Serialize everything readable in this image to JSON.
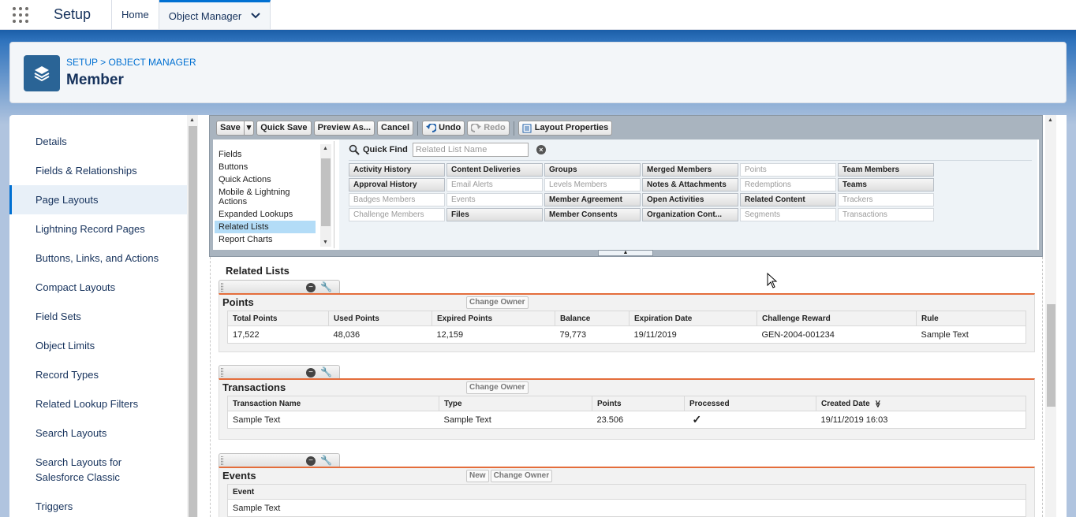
{
  "top_nav": {
    "app_name": "Setup",
    "tabs": [
      {
        "label": "Home"
      },
      {
        "label": "Object Manager"
      }
    ]
  },
  "header": {
    "breadcrumb_setup": "SETUP",
    "breadcrumb_sep": " > ",
    "breadcrumb_object_manager": "OBJECT MANAGER",
    "title": "Member",
    "icon": "layers-icon"
  },
  "sidebar": {
    "active": "Page Layouts",
    "items": [
      {
        "label": "Details"
      },
      {
        "label": "Fields & Relationships"
      },
      {
        "label": "Page Layouts"
      },
      {
        "label": "Lightning Record Pages"
      },
      {
        "label": "Buttons, Links, and Actions"
      },
      {
        "label": "Compact Layouts"
      },
      {
        "label": "Field Sets"
      },
      {
        "label": "Object Limits"
      },
      {
        "label": "Record Types"
      },
      {
        "label": "Related Lookup Filters"
      },
      {
        "label": "Search Layouts"
      },
      {
        "label": "Search Layouts for",
        "label2": "Salesforce Classic"
      },
      {
        "label": "Triggers"
      }
    ]
  },
  "toolbar": {
    "save": "Save",
    "save_dropdown": "▾",
    "quick_save": "Quick Save",
    "preview_as": "Preview As...",
    "cancel": "Cancel",
    "undo": "Undo",
    "redo": "Redo",
    "layout_properties": "Layout Properties"
  },
  "palette": {
    "categories": [
      {
        "label": "Fields"
      },
      {
        "label": "Buttons"
      },
      {
        "label": "Quick Actions"
      },
      {
        "label": "Mobile & Lightning Actions"
      },
      {
        "label": "Expanded Lookups"
      },
      {
        "label": "Related Lists"
      },
      {
        "label": "Report Charts"
      }
    ],
    "selected_category": "Related Lists",
    "quick_find_label": "Quick Find",
    "quick_find_placeholder": "Related List Name",
    "items": [
      {
        "label": "Activity History",
        "used": false
      },
      {
        "label": "Content Deliveries",
        "used": false
      },
      {
        "label": "Groups",
        "used": false
      },
      {
        "label": "Merged Members",
        "used": false
      },
      {
        "label": "Points",
        "used": true
      },
      {
        "label": "Team Members",
        "used": false
      },
      {
        "label": "Approval History",
        "used": false
      },
      {
        "label": "Email Alerts",
        "used": true
      },
      {
        "label": "Levels Members",
        "used": true
      },
      {
        "label": "Notes & Attachments",
        "used": false
      },
      {
        "label": "Redemptions",
        "used": true
      },
      {
        "label": "Teams",
        "used": false
      },
      {
        "label": "Badges Members",
        "used": true
      },
      {
        "label": "Events",
        "used": true
      },
      {
        "label": "Member Agreement",
        "used": false
      },
      {
        "label": "Open Activities",
        "used": false
      },
      {
        "label": "Related Content",
        "used": false
      },
      {
        "label": "Trackers",
        "used": true
      },
      {
        "label": "Challenge Members",
        "used": true
      },
      {
        "label": "Files",
        "used": false
      },
      {
        "label": "Member Consents",
        "used": false
      },
      {
        "label": "Organization Cont...",
        "used": false
      },
      {
        "label": "Segments",
        "used": true
      },
      {
        "label": "Transactions",
        "used": true
      }
    ],
    "handle_glyph": "▲"
  },
  "canvas": {
    "section_title": "Related Lists",
    "related_lists": [
      {
        "name": "Points",
        "buttons": [
          "Change Owner"
        ],
        "columns": [
          "Total Points",
          "Used Points",
          "Expired Points",
          "Balance",
          "Expiration Date",
          "Challenge Reward",
          "Rule"
        ],
        "row": [
          "17,522",
          "48,036",
          "12,159",
          "79,773",
          "19/11/2019",
          "GEN-2004-001234",
          "Sample Text"
        ]
      },
      {
        "name": "Transactions",
        "buttons": [
          "Change Owner"
        ],
        "columns": [
          "Transaction Name",
          "Type",
          "Points",
          "Processed",
          "Created Date"
        ],
        "sort_glyph": "≫",
        "row": [
          "Sample Text",
          "Sample Text",
          "23.506",
          "✓",
          "19/11/2019 16:03"
        ]
      },
      {
        "name": "Events",
        "buttons": [
          "New",
          "Change Owner"
        ],
        "columns": [
          "Event"
        ],
        "row": [
          "Sample Text"
        ]
      }
    ]
  },
  "colors": {
    "brand_blue": "#0070d2",
    "header_icon": "#2a6496",
    "related_list_accent": "#e46d3b"
  }
}
